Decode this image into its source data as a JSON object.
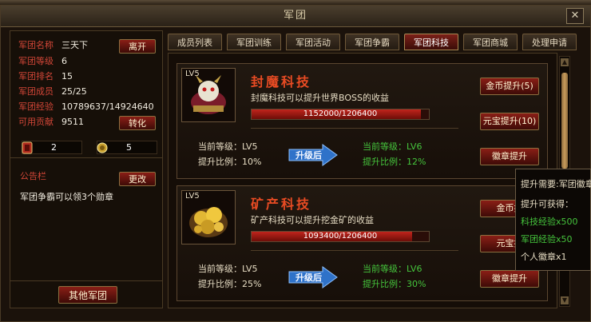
{
  "window": {
    "title": "军团"
  },
  "close_label": "✕",
  "info": {
    "rows": [
      {
        "label": "军团名称",
        "value": "三天下"
      },
      {
        "label": "军团等级",
        "value": "6"
      },
      {
        "label": "军团排名",
        "value": "15"
      },
      {
        "label": "军团成员",
        "value": "25/25"
      },
      {
        "label": "军团经验",
        "value": "10789637/14924640"
      },
      {
        "label": "可用贡献",
        "value": "9511"
      }
    ],
    "leave_label": "离开",
    "convert_label": "转化",
    "resources": [
      {
        "value": "2"
      },
      {
        "value": "5"
      }
    ]
  },
  "notice": {
    "title": "公告栏",
    "edit_label": "更改",
    "text": "军团争霸可以领3个勋章"
  },
  "other_legion_label": "其他军团",
  "tabs": [
    "成员列表",
    "军团训练",
    "军团活动",
    "军团争霸",
    "军团科技",
    "军团商城",
    "处理申请"
  ],
  "active_tab": 4,
  "tech": [
    {
      "level": "LV5",
      "name": "封魔科技",
      "desc": "封魔科技可以提升世界BOSS的收益",
      "progress_text": "1152000/1206400",
      "progress": 0.955,
      "cur_level": "当前等级：LV5",
      "cur_rate": "提升比例：10%",
      "next_level": "当前等级：LV6",
      "next_rate": "提升比例：12%",
      "upgrade_label": "升级后",
      "buttons": [
        "金币提升(5)",
        "元宝提升(10)",
        "徽章提升"
      ]
    },
    {
      "level": "LV5",
      "name": "矿产科技",
      "desc": "矿产科技可以提升挖金矿的收益",
      "progress_text": "1093400/1206400",
      "progress": 0.906,
      "cur_level": "当前等级：LV5",
      "cur_rate": "提升比例：25%",
      "next_level": "当前等级：LV6",
      "next_rate": "提升比例：30%",
      "upgrade_label": "升级后",
      "buttons": [
        "金币提",
        "元宝提",
        "徽章提升"
      ]
    }
  ],
  "tooltip": {
    "line1": "提升需要:军团徽章",
    "line2": "提升可获得：",
    "line3": "科技经验x500",
    "line4": "军团经验x50",
    "line5": "个人徽章x1"
  },
  "colors": {
    "label_red": "#d24637",
    "green": "#45c43c",
    "title_orange": "#e84b23"
  }
}
